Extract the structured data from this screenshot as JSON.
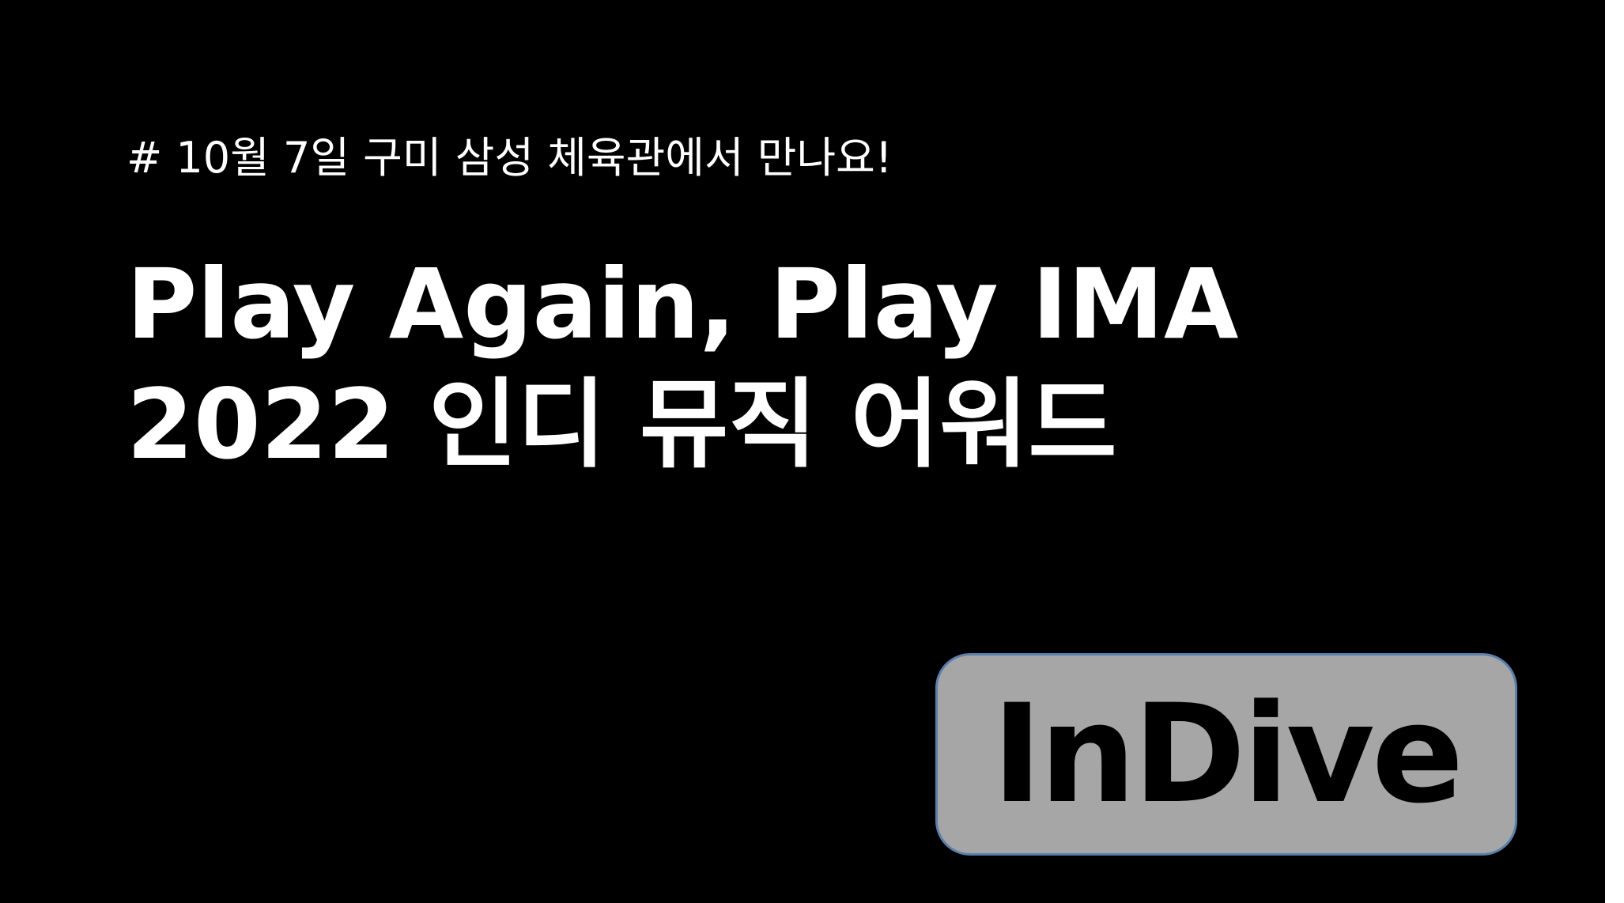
{
  "slide": {
    "subtitle": "# 10월 7일 구미 삼성 체육관에서 만나요!",
    "title_line_1": "Play Again, Play IMA",
    "title_line_2": "2022 인디 뮤직 어워드",
    "brand_label": "InDive"
  },
  "colors": {
    "background": "#000000",
    "text": "#ffffff",
    "brand_box_fill": "#a6a6a6",
    "brand_box_border": "#5b7faa",
    "brand_text": "#000000"
  }
}
